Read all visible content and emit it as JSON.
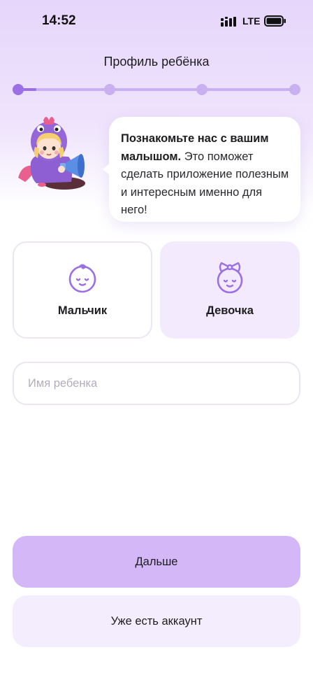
{
  "status_bar": {
    "time": "14:52",
    "network": "LTE"
  },
  "header": {
    "title": "Профиль ребёнка"
  },
  "progress": {
    "steps": 4,
    "current_step": 1,
    "fill_fraction": 0.06
  },
  "speech_bubble": {
    "bold_text": "Познакомьте нас с вашим малышом.",
    "text": " Это поможет сделать приложение полезным и интересным именно для него!"
  },
  "gender": {
    "options": [
      {
        "label": "Мальчик",
        "icon": "baby-boy-face-icon",
        "selected": false
      },
      {
        "label": "Девочка",
        "icon": "baby-girl-bow-icon",
        "selected": true
      }
    ]
  },
  "name_field": {
    "placeholder": "Имя ребенка",
    "value": ""
  },
  "buttons": {
    "next_label": "Дальше",
    "account_label": "Уже есть аккаунт"
  },
  "colors": {
    "accent": "#9b6fe6",
    "accent_light": "#d3b7f6",
    "card_selected": "#f3eafd"
  }
}
